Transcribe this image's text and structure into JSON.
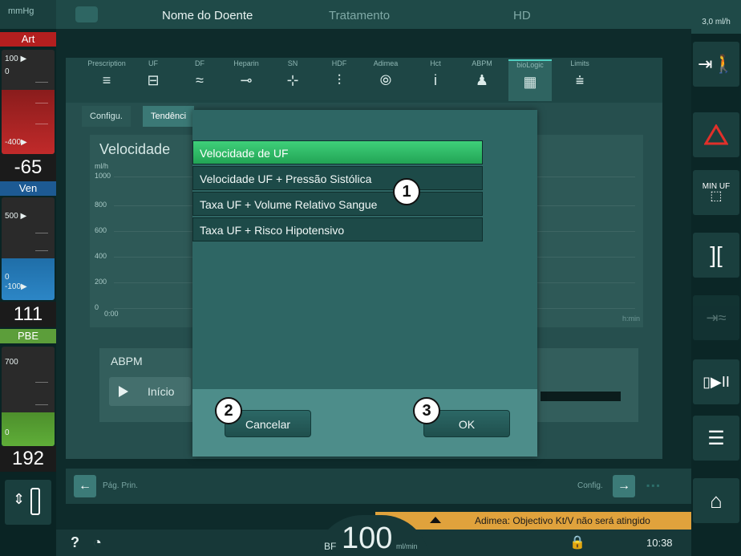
{
  "topbar": {
    "patient": "Nome do Doente",
    "treatment": "Tratamento",
    "mode": "HD"
  },
  "left": {
    "unit": "mmHg",
    "art": {
      "label": "Art",
      "high": "100 ▶",
      "low_zero": "0",
      "limit_low": "-400▶",
      "value": "-65"
    },
    "ven": {
      "label": "Ven",
      "high": "500 ▶",
      "low_zero": "0",
      "limit_low": "-100▶",
      "value": "111"
    },
    "pbe": {
      "label": "PBE",
      "high": "700",
      "low_zero": "0",
      "value": "192"
    }
  },
  "right": {
    "uf_top": "3,0  ml/h"
  },
  "tabs": [
    {
      "label": "Prescription",
      "icon": "≡"
    },
    {
      "label": "UF",
      "icon": "⊟"
    },
    {
      "label": "DF",
      "icon": "≈"
    },
    {
      "label": "Heparin",
      "icon": "⊸"
    },
    {
      "label": "SN",
      "icon": "⊹"
    },
    {
      "label": "HDF",
      "icon": "⫶"
    },
    {
      "label": "Adimea",
      "icon": "⦾"
    },
    {
      "label": "Hct",
      "icon": "i"
    },
    {
      "label": "ABPM",
      "icon": "♟"
    },
    {
      "label": "bioLogic",
      "icon": "▦"
    },
    {
      "label": "Limits",
      "icon": "⩧"
    }
  ],
  "subtabs": {
    "config": "Configu.",
    "trend": "Tendênci"
  },
  "chart": {
    "title": "Velocidade",
    "unit": "ml/h",
    "y_ticks": [
      "1000",
      "800",
      "600",
      "400",
      "200",
      "0"
    ],
    "x_start": "0:00",
    "x_unit": "h:min"
  },
  "abpm": {
    "label": "ABPM",
    "start_button": "Início"
  },
  "dialog": {
    "options": [
      "Velocidade de UF",
      "Velocidade UF + Pressão Sistólica",
      "Taxa UF + Volume Relativo Sangue",
      "Taxa UF + Risco Hipotensivo"
    ],
    "selected_index": 0,
    "cancel": "Cancelar",
    "ok": "OK"
  },
  "callouts": {
    "one": "1",
    "two": "2",
    "three": "3"
  },
  "nav": {
    "back": "Pág. Prin.",
    "config": "Config."
  },
  "alert": "Adimea: Objectivo Kt/V não será atingido",
  "status": {
    "help": "?",
    "bf_label": "BF",
    "bf_value": "100",
    "bf_unit": "ml/min",
    "time": "10:38"
  }
}
